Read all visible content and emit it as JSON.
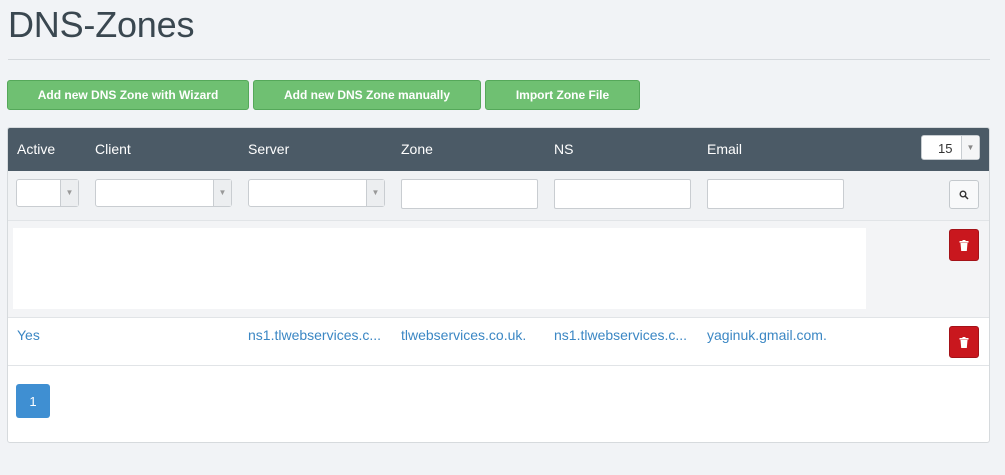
{
  "page": {
    "title": "DNS-Zones"
  },
  "actions": {
    "wizard_label": "Add new DNS Zone with Wizard",
    "manual_label": "Add new DNS Zone manually",
    "import_label": "Import Zone File"
  },
  "table": {
    "columns": {
      "active": "Active",
      "client": "Client",
      "server": "Server",
      "zone": "Zone",
      "ns": "NS",
      "email": "Email"
    },
    "per_page": "15",
    "filters": {
      "active": "",
      "client": "",
      "server": "",
      "zone": "",
      "ns": "",
      "email": ""
    },
    "rows": [
      {
        "active": "",
        "client": "",
        "server": "",
        "zone": "",
        "ns": "",
        "email": ""
      },
      {
        "active": "Yes",
        "client": "",
        "server": "ns1.tlwebservices.c...",
        "zone": "tlwebservices.co.uk.",
        "ns": "ns1.tlwebservices.c...",
        "email": "yaginuk.gmail.com."
      }
    ]
  },
  "pagination": {
    "current": "1"
  },
  "icons": {
    "search": "search-icon",
    "delete": "trash-icon",
    "dropdown": "chevron-down-icon"
  },
  "colors": {
    "header_bg": "#4b5a66",
    "button_green": "#6fc072",
    "delete_red": "#c9171e",
    "link_blue": "#3b87c4",
    "pagination_blue": "#3f8fd2"
  }
}
